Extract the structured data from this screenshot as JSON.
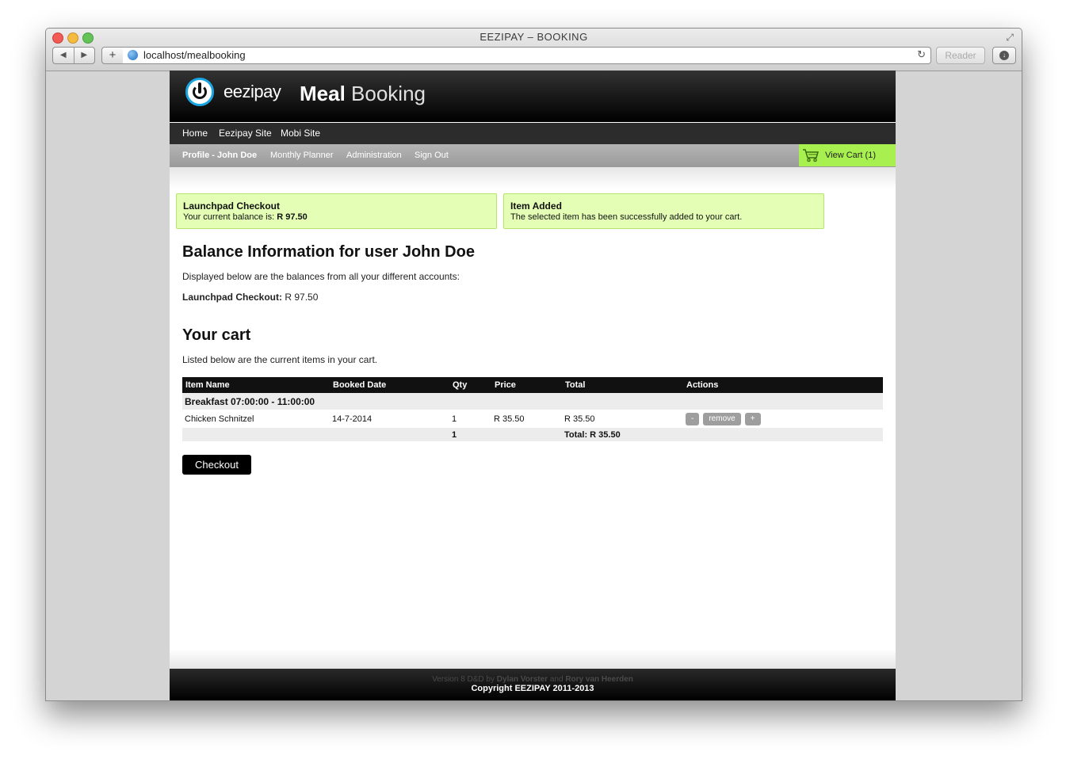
{
  "window": {
    "title": "EEZIPAY – BOOKING",
    "url": "localhost/mealbooking",
    "reader_label": "Reader",
    "back_glyph": "◀",
    "forward_glyph": "▶",
    "add_glyph": "+",
    "reload_glyph": "↻",
    "fullscreen_glyph": "⤢",
    "download_glyph": "↓"
  },
  "header": {
    "logo_text": "eezipay",
    "title_bold": "Meal",
    "title_rest": "Booking"
  },
  "nav_primary": [
    "Home",
    "Eezipay Site",
    "Mobi Site"
  ],
  "nav_secondary": [
    "Profile - John Doe",
    "Monthly Planner",
    "Administration",
    "Sign Out"
  ],
  "cart_button": {
    "label": "View Cart (1)"
  },
  "notices": [
    {
      "title": "Launchpad Checkout",
      "body_prefix": "Your current balance is: ",
      "body_value": "R 97.50"
    },
    {
      "title": "Item Added",
      "body_prefix": "The selected item has been successfully added to your cart.",
      "body_value": ""
    }
  ],
  "balance": {
    "heading": "Balance Information for user John Doe",
    "description": "Displayed below are the balances from all your different accounts:",
    "account_label": "Launchpad Checkout:",
    "account_value": "R 97.50"
  },
  "cart": {
    "heading": "Your cart",
    "description": "Listed below are the current items in your cart.",
    "columns": [
      "Item Name",
      "Booked Date",
      "Qty",
      "Price",
      "Total",
      "Actions"
    ],
    "group": "Breakfast 07:00:00 - 11:00:00",
    "items": [
      {
        "name": "Chicken Schnitzel",
        "date": "14-7-2014",
        "qty": "1",
        "price": "R 35.50",
        "total": "R 35.50"
      }
    ],
    "actions": {
      "minus": "-",
      "remove": "remove",
      "plus": "+"
    },
    "total_qty": "1",
    "total_label": "Total: R 35.50",
    "checkout_label": "Checkout"
  },
  "footer": {
    "version_prefix": "Version 8 D&D by ",
    "author1": "Dylan Vorster",
    "and": " and ",
    "author2": "Rory van Heerden",
    "copyright": "Copyright EEZIPAY 2011-2013"
  },
  "colors": {
    "cart_accent": "#a8f050",
    "notice_bg": "#e4ffb5",
    "logo_ring": "#1aa6e0"
  }
}
